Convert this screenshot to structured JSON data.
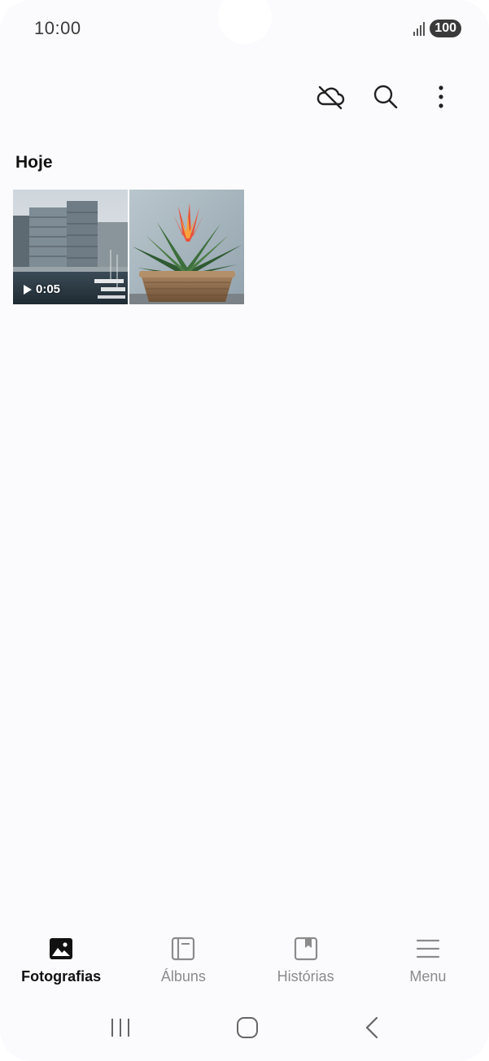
{
  "status_bar": {
    "time": "10:00",
    "battery": "100"
  },
  "section": {
    "title": "Hoje"
  },
  "media": [
    {
      "type": "video",
      "duration": "0:05",
      "subject": "harbor buildings"
    },
    {
      "type": "photo",
      "subject": "bromeliad plant in pot"
    }
  ],
  "nav": {
    "items": [
      {
        "label": "Fotografias",
        "icon": "photos-icon",
        "active": true
      },
      {
        "label": "Álbuns",
        "icon": "albums-icon",
        "active": false
      },
      {
        "label": "Histórias",
        "icon": "stories-icon",
        "active": false
      },
      {
        "label": "Menu",
        "icon": "menu-icon",
        "active": false
      }
    ]
  },
  "colors": {
    "background": "#fbfbfd",
    "text_primary": "#111111",
    "text_secondary": "#8b8b8b"
  }
}
